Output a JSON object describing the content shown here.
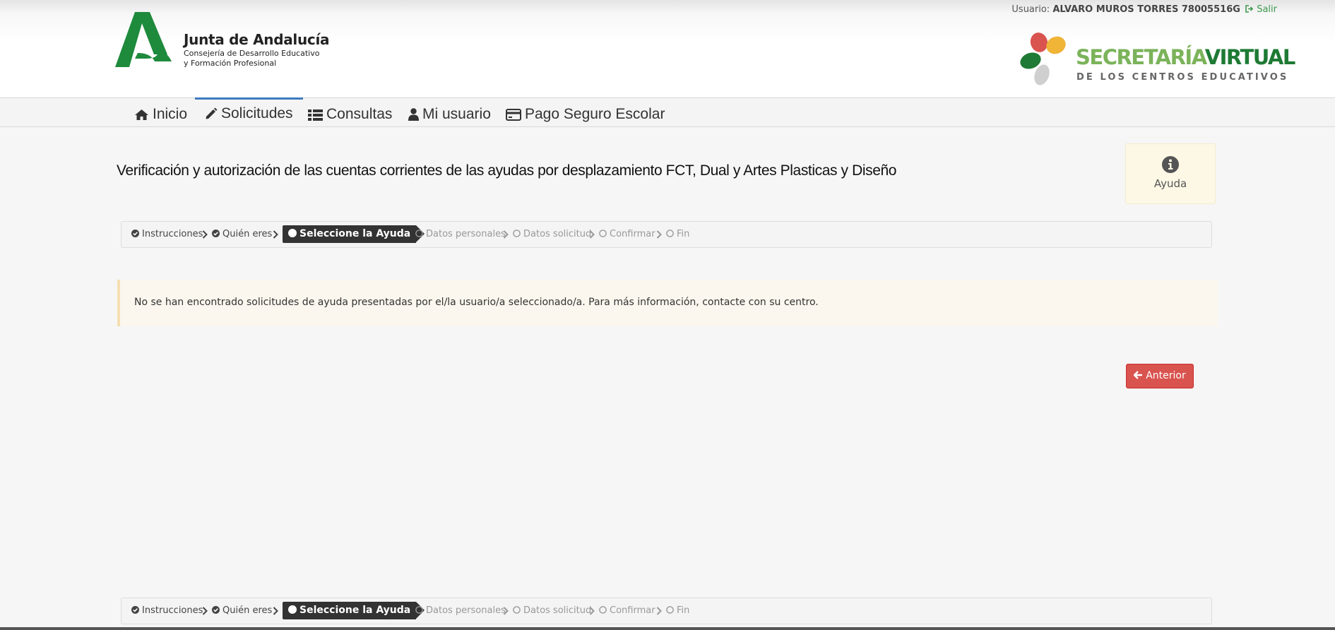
{
  "header": {
    "org_name": "Junta de Andalucía",
    "org_sub_line1": "Consejería de Desarrollo Educativo",
    "org_sub_line2": "y Formación Profesional",
    "user_label": "Usuario:",
    "user_name": "ALVARO MUROS TORRES 78005516G",
    "logout_label": "Salir",
    "app_title_part1": "SECRETARÍA",
    "app_title_part2": "VIRTUAL",
    "app_subtitle": "DE LOS CENTROS EDUCATIVOS"
  },
  "nav": {
    "items": [
      {
        "label": "Inicio",
        "icon": "home-icon"
      },
      {
        "label": "Solicitudes",
        "icon": "pencil-icon",
        "active": true
      },
      {
        "label": "Consultas",
        "icon": "list-icon"
      },
      {
        "label": "Mi usuario",
        "icon": "user-icon"
      },
      {
        "label": "Pago Seguro Escolar",
        "icon": "credit-card-icon"
      }
    ]
  },
  "page": {
    "title": "Verificación y autorización de las cuentas corrientes de las ayudas por desplazamiento FCT, Dual y Artes Plasticas y Diseño",
    "help_label": "Ayuda"
  },
  "steps": [
    {
      "label": "Instrucciones",
      "state": "done"
    },
    {
      "label": "Quién eres",
      "state": "done"
    },
    {
      "label": "Seleccione la Ayuda",
      "state": "current"
    },
    {
      "label": "Datos personales",
      "state": "todo"
    },
    {
      "label": "Datos solicitud",
      "state": "todo"
    },
    {
      "label": "Confirmar",
      "state": "todo"
    },
    {
      "label": "Fin",
      "state": "todo"
    }
  ],
  "alert": {
    "message": "No se han encontrado solicitudes de ayuda presentadas por el/la usuario/a seleccionado/a. Para más información, contacte con su centro."
  },
  "actions": {
    "previous_label": "Anterior"
  },
  "colors": {
    "nav_active": "#3e7bbf",
    "button_danger": "#d9534f",
    "alert_bg": "#fbf7ee",
    "brand_green": "#1e7a34",
    "brand_light_green": "#7bb35a"
  }
}
